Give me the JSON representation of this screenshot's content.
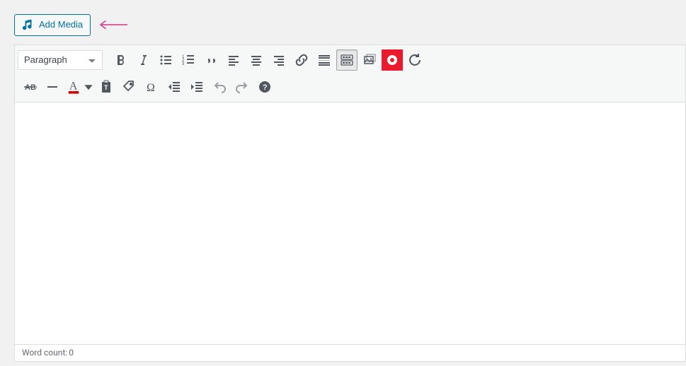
{
  "colors": {
    "accent": "#0071a1",
    "annotation": "#d63384",
    "issuu": "#eb1b2d"
  },
  "add_media": {
    "label": "Add Media"
  },
  "format_select": {
    "value": "Paragraph"
  },
  "toolbar": {
    "row1": [
      {
        "name": "bold-icon",
        "title": "Bold"
      },
      {
        "name": "italic-icon",
        "title": "Italic"
      },
      {
        "name": "bulleted-list-icon",
        "title": "Bulleted list"
      },
      {
        "name": "numbered-list-icon",
        "title": "Numbered list"
      },
      {
        "name": "blockquote-icon",
        "title": "Blockquote"
      },
      {
        "name": "align-left-icon",
        "title": "Align left"
      },
      {
        "name": "align-center-icon",
        "title": "Align center"
      },
      {
        "name": "align-right-icon",
        "title": "Align right"
      },
      {
        "name": "link-icon",
        "title": "Insert/edit link"
      },
      {
        "name": "read-more-icon",
        "title": "Insert Read More tag"
      },
      {
        "name": "toolbar-toggle-icon",
        "title": "Toolbar Toggle",
        "active": true
      },
      {
        "name": "media-gallery-icon",
        "title": "Media gallery"
      },
      {
        "name": "issuu-icon",
        "title": "Issuu"
      },
      {
        "name": "refresh-icon",
        "title": "Refresh"
      }
    ],
    "row2": [
      {
        "name": "strikethrough-icon",
        "title": "Strikethrough"
      },
      {
        "name": "horizontal-line-icon",
        "title": "Horizontal line"
      },
      {
        "name": "text-color-icon",
        "title": "Text color"
      },
      {
        "name": "paste-text-icon",
        "title": "Paste as text"
      },
      {
        "name": "tag-icon",
        "title": "Tag"
      },
      {
        "name": "special-character-icon",
        "title": "Special character"
      },
      {
        "name": "decrease-indent-icon",
        "title": "Decrease indent"
      },
      {
        "name": "increase-indent-icon",
        "title": "Increase indent"
      },
      {
        "name": "undo-icon",
        "title": "Undo"
      },
      {
        "name": "redo-icon",
        "title": "Redo"
      },
      {
        "name": "help-icon",
        "title": "Keyboard Shortcuts"
      }
    ]
  },
  "statusbar": {
    "word_count_label": "Word count:",
    "word_count_value": "0"
  }
}
